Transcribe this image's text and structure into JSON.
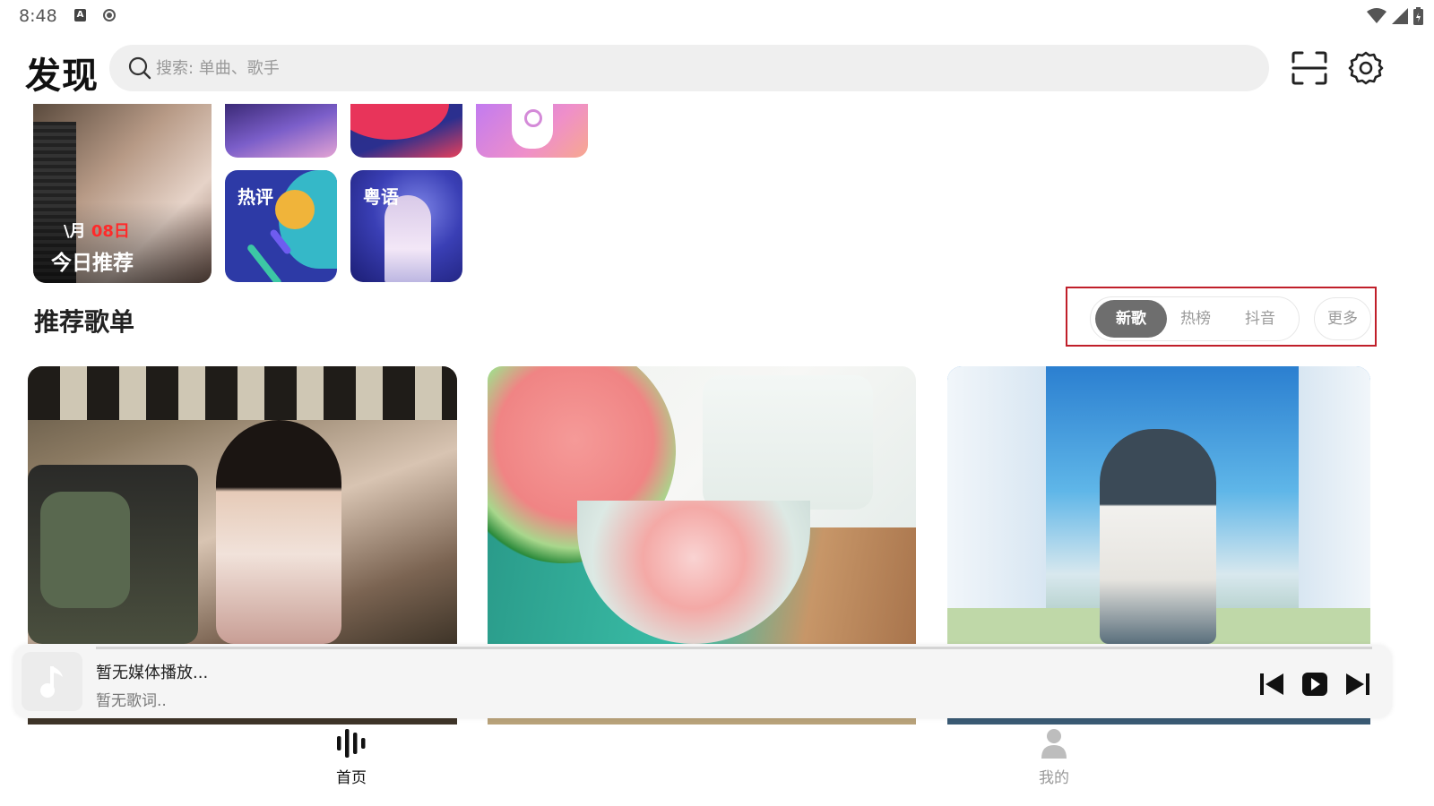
{
  "status_bar": {
    "time": "8:48",
    "icons": [
      "a-notification-icon",
      "recording-icon",
      "wifi-icon",
      "signal-icon",
      "battery-icon"
    ]
  },
  "header": {
    "title": "发现",
    "search_placeholder": "搜索: 单曲、歌手",
    "icons": [
      "search-icon",
      "scan-icon",
      "settings-icon"
    ]
  },
  "tiles": {
    "daily": {
      "date_month": "\\月",
      "date_day": "08日",
      "title": "今日推荐"
    },
    "hot": {
      "label": "热评"
    },
    "cantonese": {
      "label": "粤语"
    }
  },
  "recommend": {
    "title": "推荐歌单",
    "tabs": [
      {
        "label": "新歌",
        "active": true
      },
      {
        "label": "热榜",
        "active": false
      },
      {
        "label": "抖音",
        "active": false
      }
    ],
    "more_label": "更多"
  },
  "player": {
    "title": "暂无媒体播放...",
    "lyric": "暂无歌词..",
    "controls": [
      "previous-icon",
      "play-icon",
      "next-icon"
    ]
  },
  "bottom_nav": [
    {
      "label": "首页",
      "active": true,
      "icon": "equalizer-icon"
    },
    {
      "label": "我的",
      "active": false,
      "icon": "person-icon"
    }
  ],
  "colors": {
    "accent_active_tab": "#6e6e6e",
    "highlight_box": "#c01f2a",
    "date_red": "#ff2a2a"
  }
}
